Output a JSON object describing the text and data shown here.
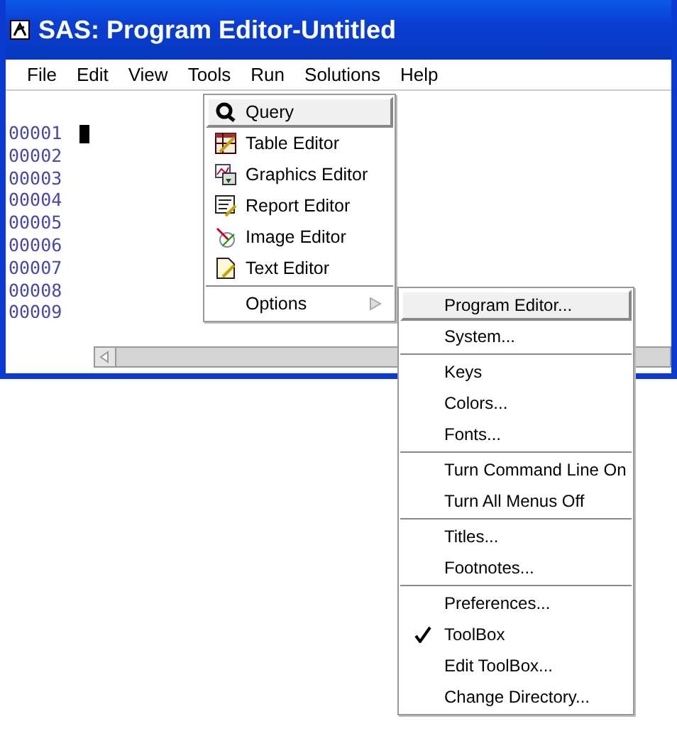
{
  "window": {
    "title": "SAS: Program Editor-Untitled"
  },
  "menu_bar": [
    "File",
    "Edit",
    "View",
    "Tools",
    "Run",
    "Solutions",
    "Help"
  ],
  "editor": {
    "line_numbers": [
      "00001",
      "00002",
      "00003",
      "00004",
      "00005",
      "00006",
      "00007",
      "00008",
      "00009"
    ]
  },
  "tools_menu": [
    {
      "kind": "item",
      "label": "Query",
      "selected": true
    },
    {
      "kind": "item",
      "label": "Table Editor",
      "selected": false
    },
    {
      "kind": "item",
      "label": "Graphics Editor",
      "selected": false
    },
    {
      "kind": "item",
      "label": "Report Editor",
      "selected": false
    },
    {
      "kind": "item",
      "label": "Image Editor",
      "selected": false
    },
    {
      "kind": "item",
      "label": "Text Editor",
      "selected": false
    },
    {
      "kind": "separator"
    },
    {
      "kind": "submenu",
      "label": "Options",
      "selected": false
    }
  ],
  "options_menu": [
    {
      "kind": "item",
      "label": "Program Editor...",
      "selected": true,
      "checked": false
    },
    {
      "kind": "item",
      "label": "System...",
      "selected": false,
      "checked": false
    },
    {
      "kind": "separator"
    },
    {
      "kind": "item",
      "label": "Keys",
      "selected": false,
      "checked": false
    },
    {
      "kind": "item",
      "label": "Colors...",
      "selected": false,
      "checked": false
    },
    {
      "kind": "item",
      "label": "Fonts...",
      "selected": false,
      "checked": false
    },
    {
      "kind": "separator"
    },
    {
      "kind": "item",
      "label": "Turn Command Line On",
      "selected": false,
      "checked": false
    },
    {
      "kind": "item",
      "label": "Turn All Menus Off",
      "selected": false,
      "checked": false
    },
    {
      "kind": "separator"
    },
    {
      "kind": "item",
      "label": "Titles...",
      "selected": false,
      "checked": false
    },
    {
      "kind": "item",
      "label": "Footnotes...",
      "selected": false,
      "checked": false
    },
    {
      "kind": "separator"
    },
    {
      "kind": "item",
      "label": "Preferences...",
      "selected": false,
      "checked": false
    },
    {
      "kind": "item",
      "label": "ToolBox",
      "selected": false,
      "checked": true
    },
    {
      "kind": "item",
      "label": "Edit ToolBox...",
      "selected": false,
      "checked": false
    },
    {
      "kind": "item",
      "label": "Change Directory...",
      "selected": false,
      "checked": false
    }
  ]
}
